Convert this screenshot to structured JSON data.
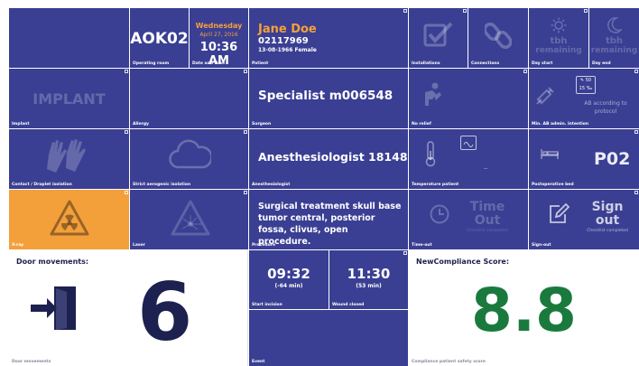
{
  "header": {
    "room_value": "AOK02",
    "room_caption": "Operating room",
    "weekday": "Wednesday",
    "date": "April 27, 2016",
    "time": "10:36 AM",
    "datetime_caption": "Date and time",
    "patient_name": "Jane Doe",
    "patient_id": "02117969",
    "patient_info": "13-08-1966 Female",
    "patient_caption": "Patient"
  },
  "installations": {
    "caption": "Installations",
    "icon": "checkbox-icon"
  },
  "connections": {
    "caption": "Connections",
    "icon": "link-icon"
  },
  "day_start": {
    "line1": "tbh",
    "line2": "remaining",
    "caption": "Day start",
    "icon": "sun-icon"
  },
  "day_end": {
    "line1": "tbh",
    "line2": "remaining",
    "caption": "Day end",
    "icon": "moon-icon"
  },
  "implant": {
    "value": "IMPLANT",
    "caption": "Implant"
  },
  "allergy": {
    "caption": "Allergy"
  },
  "surgeon": {
    "value": "Specialist m006548",
    "caption": "Surgeon"
  },
  "no_relief": {
    "caption": "No relief",
    "icon": "person-relief-icon"
  },
  "antibiotics": {
    "box_top": "✎ 50",
    "box_bottom": "15 ‰",
    "text": "AB according to protocol",
    "caption": "Min. AB admin. intention",
    "icon": "syringe-icon"
  },
  "contact_isolation": {
    "caption": "Contact / Droplet isolation",
    "icon": "gloves-icon"
  },
  "strict_isolation": {
    "caption": "Strict aerogenic isolation",
    "icon": "cloud-icon"
  },
  "anesthesiologist": {
    "value": "Anesthesiologist 18148",
    "caption": "Anesthesiologist"
  },
  "temperature": {
    "value": "--",
    "caption": "Temperature patient",
    "icon": "thermometer-icon"
  },
  "postoperative_bed": {
    "value": "P02",
    "caption": "Postoperative bed",
    "icon": "bed-icon"
  },
  "xray": {
    "caption": "X-ray",
    "icon": "radiation-icon"
  },
  "laser": {
    "caption": "Laser",
    "icon": "laser-icon"
  },
  "procedure": {
    "value": "Surgical treatment skull base tumor central, posterior fossa, clivus, open procedure.",
    "caption": "Procedure"
  },
  "timeout": {
    "line1": "Time",
    "line2": "Out",
    "sub": "Checklist completed",
    "caption": "Time-out",
    "icon": "clock-icon"
  },
  "signout": {
    "line1": "Sign",
    "line2": "out",
    "sub": "Checklist completed",
    "caption": "Sign-out",
    "icon": "pen-icon"
  },
  "door": {
    "title": "Door movements:",
    "value": "6",
    "caption": "Door movements",
    "icon": "door-enter-icon"
  },
  "incision": {
    "time": "09:32",
    "delta": "(-64 min)",
    "caption": "Start incision"
  },
  "wound": {
    "time": "11:30",
    "delta": "(53 min)",
    "caption": "Wound closed"
  },
  "event": {
    "caption": "Event"
  },
  "compliance": {
    "title": "NewCompliance Score:",
    "value": "8.8",
    "caption": "Compliance patient safety score"
  },
  "colors": {
    "tile": "#3a3f93",
    "orange": "#f3a03b",
    "score_green": "#1a7a3e",
    "door_dark": "#1c2150"
  }
}
